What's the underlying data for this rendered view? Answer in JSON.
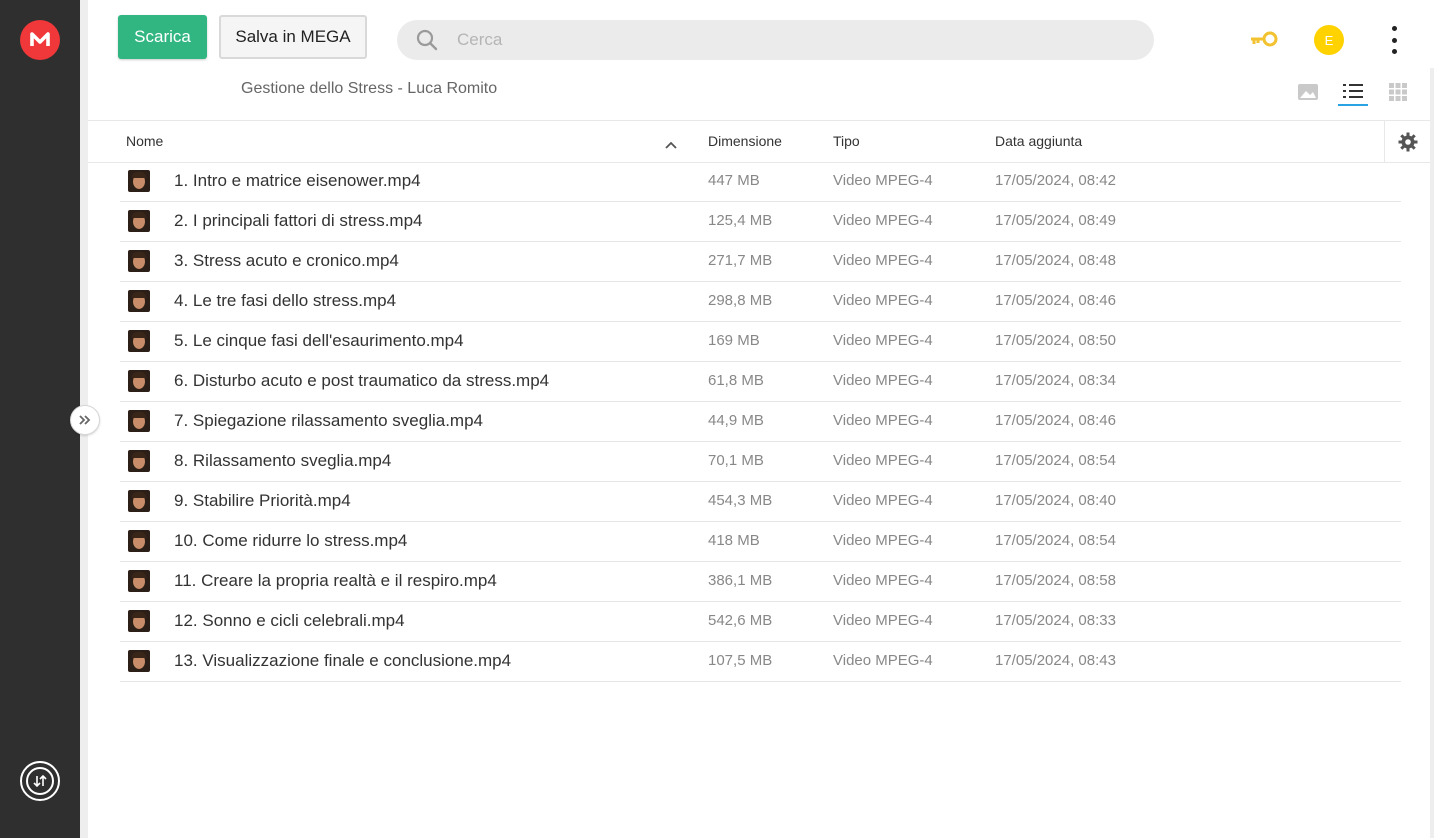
{
  "sidebar": {
    "logo_letter": "M",
    "logo_color": "#f0373a"
  },
  "toolbar": {
    "download_label": "Scarica",
    "save_label": "Salva in MEGA"
  },
  "search": {
    "placeholder": "Cerca"
  },
  "header": {
    "avatar_initial": "E",
    "avatar_color": "#ffd200"
  },
  "breadcrumb": {
    "path": "Gestione dello Stress - Luca Romito"
  },
  "columns": {
    "name": "Nome",
    "size": "Dimensione",
    "type": "Tipo",
    "date": "Data aggiunta"
  },
  "files": [
    {
      "name": "1. Intro e matrice eisenower.mp4",
      "size": "447 MB",
      "type": "Video MPEG-4",
      "date": "17/05/2024, 08:42"
    },
    {
      "name": "2. I principali fattori di stress.mp4",
      "size": "125,4 MB",
      "type": "Video MPEG-4",
      "date": "17/05/2024, 08:49"
    },
    {
      "name": "3. Stress acuto e cronico.mp4",
      "size": "271,7 MB",
      "type": "Video MPEG-4",
      "date": "17/05/2024, 08:48"
    },
    {
      "name": "4. Le tre fasi dello stress.mp4",
      "size": "298,8 MB",
      "type": "Video MPEG-4",
      "date": "17/05/2024, 08:46"
    },
    {
      "name": "5. Le cinque fasi dell'esaurimento.mp4",
      "size": "169 MB",
      "type": "Video MPEG-4",
      "date": "17/05/2024, 08:50"
    },
    {
      "name": "6. Disturbo acuto e post traumatico da stress.mp4",
      "size": "61,8 MB",
      "type": "Video MPEG-4",
      "date": "17/05/2024, 08:34"
    },
    {
      "name": "7. Spiegazione rilassamento sveglia.mp4",
      "size": "44,9 MB",
      "type": "Video MPEG-4",
      "date": "17/05/2024, 08:46"
    },
    {
      "name": "8. Rilassamento sveglia.mp4",
      "size": "70,1 MB",
      "type": "Video MPEG-4",
      "date": "17/05/2024, 08:54"
    },
    {
      "name": "9. Stabilire Priorità.mp4",
      "size": "454,3 MB",
      "type": "Video MPEG-4",
      "date": "17/05/2024, 08:40"
    },
    {
      "name": "10. Come ridurre lo stress.mp4",
      "size": "418 MB",
      "type": "Video MPEG-4",
      "date": "17/05/2024, 08:54"
    },
    {
      "name": "11. Creare la propria realtà e il respiro.mp4",
      "size": "386,1 MB",
      "type": "Video MPEG-4",
      "date": "17/05/2024, 08:58"
    },
    {
      "name": "12. Sonno e cicli celebrali.mp4",
      "size": "542,6 MB",
      "type": "Video MPEG-4",
      "date": "17/05/2024, 08:33"
    },
    {
      "name": "13. Visualizzazione finale e conclusione.mp4",
      "size": "107,5 MB",
      "type": "Video MPEG-4",
      "date": "17/05/2024, 08:43"
    }
  ]
}
